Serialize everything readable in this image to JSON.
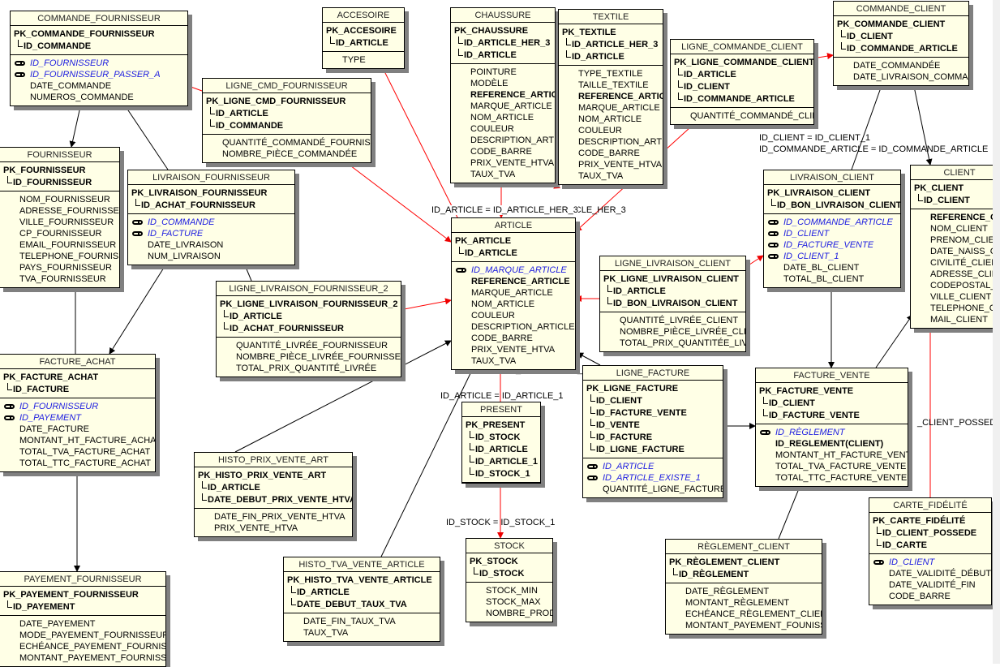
{
  "entities": [
    {
      "id": "commande_fournisseur",
      "title": "COMMANDE_FOURNISSEUR",
      "pk": "PK_COMMANDE_FOURNISSEUR",
      "pk_cols": [
        "ID_COMMANDE"
      ],
      "fks": [
        "ID_FOURNISSEUR",
        "ID_FOURNISSEUR_PASSER_A"
      ],
      "bold": [],
      "attrs": [
        "DATE_COMMANDE",
        "NUMEROS_COMMANDE"
      ]
    },
    {
      "id": "fournisseur",
      "title": "FOURNISSEUR",
      "pk": "PK_FOURNISSEUR",
      "pk_cols": [
        "ID_FOURNISSEUR"
      ],
      "fks": [],
      "bold": [],
      "attrs": [
        "NOM_FOURNISSEUR",
        "ADRESSE_FOURNISSEUR",
        "VILLE_FOURNISSEUR",
        "CP_FOURNISSEUR",
        "EMAIL_FOURNISSEUR",
        "TELEPHONE_FOURNISSEUR",
        "PAYS_FOURNISSEUR",
        "TVA_FOURNISSEUR"
      ]
    },
    {
      "id": "ligne_cmd_fournisseur",
      "title": "LIGNE_CMD_FOURNISSEUR",
      "pk": "PK_LIGNE_CMD_FOURNISSEUR",
      "pk_cols": [
        "ID_ARTICLE",
        "ID_COMMANDE"
      ],
      "fks": [],
      "bold": [],
      "attrs": [
        "QUANTITÉ_COMMANDÉ_FOURNISSEUR",
        "NOMBRE_PIÈCE_COMMANDÉE"
      ]
    },
    {
      "id": "accesoire",
      "title": "ACCESOIRE",
      "pk": "PK_ACCESOIRE",
      "pk_cols": [
        "ID_ARTICLE"
      ],
      "fks": [],
      "bold": [],
      "attrs": [
        "TYPE"
      ]
    },
    {
      "id": "chaussure",
      "title": "CHAUSSURE",
      "pk": "PK_CHAUSSURE",
      "pk_cols": [
        "ID_ARTICLE_HER_3",
        "ID_ARTICLE"
      ],
      "fks": [],
      "bold": [],
      "attrs": [
        "POINTURE",
        "MODÈLE",
        "*REFERENCE_ARTICLE",
        "MARQUE_ARTICLE",
        "NOM_ARTICLE",
        "COULEUR",
        "DESCRIPTION_ARTICLE",
        "CODE_BARRE",
        "PRIX_VENTE_HTVA",
        "TAUX_TVA"
      ]
    },
    {
      "id": "textile",
      "title": "TEXTILE",
      "pk": "PK_TEXTILE",
      "pk_cols": [
        "ID_ARTICLE_HER_3",
        "ID_ARTICLE"
      ],
      "fks": [],
      "bold": [],
      "attrs": [
        "TYPE_TEXTILE",
        "TAILLE_TEXTILE",
        "*REFERENCE_ARTICLE",
        "MARQUE_ARTICLE",
        "NOM_ARTICLE",
        "COULEUR",
        "DESCRIPTION_ARTICLE",
        "CODE_BARRE",
        "PRIX_VENTE_HTVA",
        "TAUX_TVA"
      ]
    },
    {
      "id": "ligne_commande_client",
      "title": "LIGNE_COMMANDE_CLIENT",
      "pk": "PK_LIGNE_COMMANDE_CLIENT",
      "pk_cols": [
        "ID_ARTICLE",
        "ID_CLIENT",
        "ID_COMMANDE_ARTICLE"
      ],
      "fks": [],
      "bold": [],
      "attrs": [
        "QUANTITÉ_COMMANDÉ_CLIENT"
      ]
    },
    {
      "id": "commande_client",
      "title": "COMMANDE_CLIENT",
      "pk": "PK_COMMANDE_CLIENT",
      "pk_cols": [
        "ID_CLIENT",
        "ID_COMMANDE_ARTICLE"
      ],
      "fks": [],
      "bold": [],
      "attrs": [
        "DATE_COMMANDÉE",
        "DATE_LIVRAISON_COMMANDE"
      ]
    },
    {
      "id": "livraison_fournisseur",
      "title": "LIVRAISON_FOURNISSEUR",
      "pk": "PK_LIVRAISON_FOURNISSEUR",
      "pk_cols": [
        "ID_ACHAT_FOURNISSEUR"
      ],
      "fks": [
        "ID_COMMANDE",
        "ID_FACTURE"
      ],
      "bold": [],
      "attrs": [
        "DATE_LIVRAISON",
        "NUM_LIVRAISON"
      ]
    },
    {
      "id": "article",
      "title": "ARTICLE",
      "pk": "PK_ARTICLE",
      "pk_cols": [
        "ID_ARTICLE"
      ],
      "fks": [
        "ID_MARQUE_ARTICLE"
      ],
      "bold": [
        "REFERENCE_ARTICLE"
      ],
      "attrs": [
        "MARQUE_ARTICLE",
        "NOM_ARTICLE",
        "COULEUR",
        "DESCRIPTION_ARTICLE",
        "CODE_BARRE",
        "PRIX_VENTE_HTVA",
        "TAUX_TVA"
      ]
    },
    {
      "id": "livraison_client",
      "title": "LIVRAISON_CLIENT",
      "pk": "PK_LIVRAISON_CLIENT",
      "pk_cols": [
        "ID_BON_LIVRAISON_CLIENT"
      ],
      "fks": [
        "ID_COMMANDE_ARTICLE",
        "ID_CLIENT",
        "ID_FACTURE_VENTE",
        "ID_CLIENT_1"
      ],
      "bold": [],
      "attrs": [
        "DATE_BL_CLIENT",
        "TOTAL_BL_CLIENT"
      ]
    },
    {
      "id": "client",
      "title": "CLIENT",
      "pk": "PK_CLIENT",
      "pk_cols": [
        "ID_CLIENT"
      ],
      "fks": [],
      "bold": [],
      "attrs": [
        "*REFERENCE_CLIENT",
        "NOM_CLIENT",
        "PRENOM_CLIENT",
        "DATE_NAISS_CLIENT",
        "CIVILITÉ_CLIENT",
        "ADRESSE_CLIENT",
        "CODEPOSTAL_CLIENT",
        "VILLE_CLIENT",
        "TELEPHONE_CLIENT",
        "MAIL_CLIENT"
      ]
    },
    {
      "id": "ligne_livraison_fournisseur_2",
      "title": "LIGNE_LIVRAISON_FOURNISSEUR_2",
      "pk": "PK_LIGNE_LIVRAISON_FOURNISSEUR_2",
      "pk_cols": [
        "ID_ARTICLE",
        "ID_ACHAT_FOURNISSEUR"
      ],
      "fks": [],
      "bold": [],
      "attrs": [
        "QUANTITÉ_LIVRÉE_FOURNISSEUR",
        "NOMBRE_PIÈCE_LIVRÉE_FOURNISSEUR",
        "TOTAL_PRIX_QUANTITÉ_LIVRÉE"
      ]
    },
    {
      "id": "ligne_livraison_client",
      "title": "LIGNE_LIVRAISON_CLIENT",
      "pk": "PK_LIGNE_LIVRAISON_CLIENT",
      "pk_cols": [
        "ID_ARTICLE",
        "ID_BON_LIVRAISON_CLIENT"
      ],
      "fks": [],
      "bold": [],
      "attrs": [
        "QUANTITÉ_LIVRÉE_CLIENT",
        "NOMBRE_PIÈCE_LIVRÉE_CLIENT",
        "TOTAL_PRIX_QUANTITÉE_LIVRÉE"
      ]
    },
    {
      "id": "facture_achat",
      "title": "FACTURE_ACHAT",
      "pk": "PK_FACTURE_ACHAT",
      "pk_cols": [
        "ID_FACTURE"
      ],
      "fks": [
        "ID_FOURNISSEUR",
        "ID_PAYEMENT"
      ],
      "bold": [],
      "attrs": [
        "DATE_FACTURE",
        "MONTANT_HT_FACTURE_ACHAT",
        "TOTAL_TVA_FACTURE_ACHAT",
        "TOTAL_TTC_FACTURE_ACHAT"
      ]
    },
    {
      "id": "present",
      "title": "PRESENT",
      "pk": "PK_PRESENT",
      "pk_cols": [
        "ID_STOCK",
        "ID_ARTICLE",
        "ID_ARTICLE_1",
        "ID_STOCK_1"
      ],
      "fks": [],
      "bold": [],
      "attrs": []
    },
    {
      "id": "ligne_facture",
      "title": "LIGNE_FACTURE",
      "pk": "PK_LIGNE_FACTURE",
      "pk_cols": [
        "ID_CLIENT",
        "ID_FACTURE_VENTE",
        "ID_VENTE",
        "ID_FACTURE",
        "ID_LIGNE_FACTURE"
      ],
      "fks": [
        "ID_ARTICLE",
        "ID_ARTICLE_EXISTE_1"
      ],
      "bold": [],
      "attrs": [
        "QUANTITÉ_LIGNE_FACTURE"
      ]
    },
    {
      "id": "facture_vente",
      "title": "FACTURE_VENTE",
      "pk": "PK_FACTURE_VENTE",
      "pk_cols": [
        "ID_CLIENT",
        "ID_FACTURE_VENTE"
      ],
      "fks": [
        "ID_RÈGLEMENT"
      ],
      "bold": [
        "ID_REGLEMENT(CLIENT)"
      ],
      "attrs": [
        "MONTANT_HT_FACTURE_VENTE",
        "TOTAL_TVA_FACTURE_VENTE",
        "TOTAL_TTC_FACTURE_VENTE"
      ]
    },
    {
      "id": "histo_prix_vente_art",
      "title": "HISTO_PRIX_VENTE_ART",
      "pk": "PK_HISTO_PRIX_VENTE_ART",
      "pk_cols": [
        "ID_ARTICLE",
        "DATE_DEBUT_PRIX_VENTE_HTVA"
      ],
      "fks": [],
      "bold": [],
      "attrs": [
        "DATE_FIN_PRIX_VENTE_HTVA",
        "PRIX_VENTE_HTVA"
      ]
    },
    {
      "id": "stock",
      "title": "STOCK",
      "pk": "PK_STOCK",
      "pk_cols": [
        "ID_STOCK"
      ],
      "fks": [],
      "bold": [],
      "attrs": [
        "STOCK_MIN",
        "STOCK_MAX",
        "NOMBRE_PRODUIT"
      ]
    },
    {
      "id": "histo_tva_vente_article",
      "title": "HISTO_TVA_VENTE_ARTICLE",
      "pk": "PK_HISTO_TVA_VENTE_ARTICLE",
      "pk_cols": [
        "ID_ARTICLE",
        "DATE_DEBUT_TAUX_TVA"
      ],
      "fks": [],
      "bold": [],
      "attrs": [
        "DATE_FIN_TAUX_TVA",
        "TAUX_TVA"
      ]
    },
    {
      "id": "payement_fournisseur",
      "title": "PAYEMENT_FOURNISSEUR",
      "pk": "PK_PAYEMENT_FOURNISSEUR",
      "pk_cols": [
        "ID_PAYEMENT"
      ],
      "fks": [],
      "bold": [],
      "attrs": [
        "DATE_PAYEMENT",
        "MODE_PAYEMENT_FOURNISSEUR",
        "ECHÉANCE_PAYEMENT_FOURNISSEUR",
        "MONTANT_PAYEMENT_FOURNISSEUR"
      ]
    },
    {
      "id": "reglement_client",
      "title": "RÈGLEMENT_CLIENT",
      "pk": "PK_RÈGLEMENT_CLIENT",
      "pk_cols": [
        "ID_RÈGLEMENT"
      ],
      "fks": [],
      "bold": [],
      "attrs": [
        "DATE_RÈGLEMENT",
        "MONTANT_RÈGLEMENT",
        "ECHÉANCE_RÈGLEMENT_CLIENT",
        "MONTANT_PAYEMENT_FOUNISSEUR"
      ]
    },
    {
      "id": "carte_fidelite",
      "title": "CARTE_FIDÉLITÉ",
      "pk": "PK_CARTE_FIDÉLITÉ",
      "pk_cols": [
        "ID_CLIENT_POSSEDE",
        "ID_CARTE"
      ],
      "fks": [
        "ID_CLIENT"
      ],
      "bold": [],
      "attrs": [
        "DATE_VALIDITÉ_DÉBUT",
        "DATE_VALIDITÉ_FIN",
        "CODE_BARRE"
      ]
    }
  ],
  "relationship_labels": {
    "article_her_3": "ID_ARTICLE = ID_ARTICLE_HER_3",
    "article_her_3_b": "TICLE_HER_3",
    "client_1": "ID_CLIENT = ID_CLIENT_1",
    "commande_article": "ID_COMMANDE_ARTICLE = ID_COMMANDE_ARTICLE",
    "article_ar": "ID_ARTICLE = ID_AR",
    "article_1": "ID_ARTICLE = ID_ARTICLE_1",
    "stock_1": "ID_STOCK = ID_STOCK_1",
    "client_possede": "_CLIENT_POSSEDE"
  },
  "colors": {
    "entity_fill": "#ffffe6",
    "foreign_key": "#2020e0",
    "inheritance_line": "#ff0000",
    "reference_line": "#000000"
  }
}
